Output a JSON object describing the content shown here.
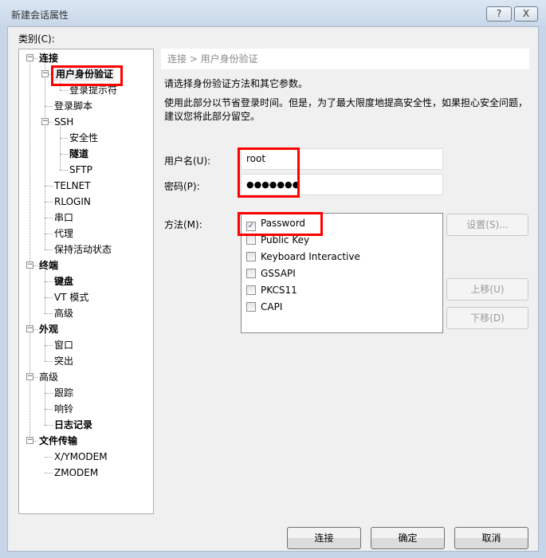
{
  "window": {
    "title": "新建会话属性",
    "help_label": "?",
    "close_label": "X"
  },
  "category_label": "类别(C):",
  "tree": [
    {
      "label": "连接",
      "level": 0,
      "bold": true,
      "expander": "minus"
    },
    {
      "label": "用户身份验证",
      "level": 1,
      "bold": true,
      "expander": "minus",
      "selected": true
    },
    {
      "label": "登录提示符",
      "level": 2,
      "bold": false
    },
    {
      "label": "登录脚本",
      "level": 1,
      "bold": false
    },
    {
      "label": "SSH",
      "level": 1,
      "bold": false,
      "expander": "minus"
    },
    {
      "label": "安全性",
      "level": 2,
      "bold": false
    },
    {
      "label": "隧道",
      "level": 2,
      "bold": true
    },
    {
      "label": "SFTP",
      "level": 2,
      "bold": false
    },
    {
      "label": "TELNET",
      "level": 1,
      "bold": false
    },
    {
      "label": "RLOGIN",
      "level": 1,
      "bold": false
    },
    {
      "label": "串口",
      "level": 1,
      "bold": false
    },
    {
      "label": "代理",
      "level": 1,
      "bold": false
    },
    {
      "label": "保持活动状态",
      "level": 1,
      "bold": false
    },
    {
      "label": "终端",
      "level": 0,
      "bold": true,
      "expander": "minus"
    },
    {
      "label": "键盘",
      "level": 1,
      "bold": true
    },
    {
      "label": "VT 模式",
      "level": 1,
      "bold": false
    },
    {
      "label": "高级",
      "level": 1,
      "bold": false
    },
    {
      "label": "外观",
      "level": 0,
      "bold": true,
      "expander": "minus"
    },
    {
      "label": "窗口",
      "level": 1,
      "bold": false
    },
    {
      "label": "突出",
      "level": 1,
      "bold": false
    },
    {
      "label": "高级",
      "level": 0,
      "bold": false,
      "expander": "minus"
    },
    {
      "label": "跟踪",
      "level": 1,
      "bold": false
    },
    {
      "label": "响铃",
      "level": 1,
      "bold": false
    },
    {
      "label": "日志记录",
      "level": 1,
      "bold": true
    },
    {
      "label": "文件传输",
      "level": 0,
      "bold": true,
      "expander": "minus"
    },
    {
      "label": "X/YMODEM",
      "level": 1,
      "bold": false
    },
    {
      "label": "ZMODEM",
      "level": 1,
      "bold": false
    }
  ],
  "main": {
    "breadcrumb": "连接 > 用户身份验证",
    "intro": "请选择身份验证方法和其它参数。",
    "note_line1": "使用此部分以节省登录时间。但是，为了最大限度地提高安全性，如果担心安全问题，",
    "note_line2": "建议您将此部分留空。",
    "username_label": "用户名(U):",
    "username_value": "root",
    "password_label": "密码(P):",
    "password_value": "●●●●●●●",
    "method_label": "方法(M):",
    "methods": [
      {
        "label": "Password",
        "checked": true
      },
      {
        "label": "Public Key",
        "checked": false
      },
      {
        "label": "Keyboard Interactive",
        "checked": false
      },
      {
        "label": "GSSAPI",
        "checked": false
      },
      {
        "label": "PKCS11",
        "checked": false
      },
      {
        "label": "CAPI",
        "checked": false
      }
    ],
    "settings_button": "设置(S)...",
    "move_up_button": "上移(U)",
    "move_down_button": "下移(D)"
  },
  "footer": {
    "connect": "连接",
    "ok": "确定",
    "cancel": "取消"
  },
  "colors": {
    "highlight": "#ff0000",
    "check": "#3a5fa8"
  }
}
